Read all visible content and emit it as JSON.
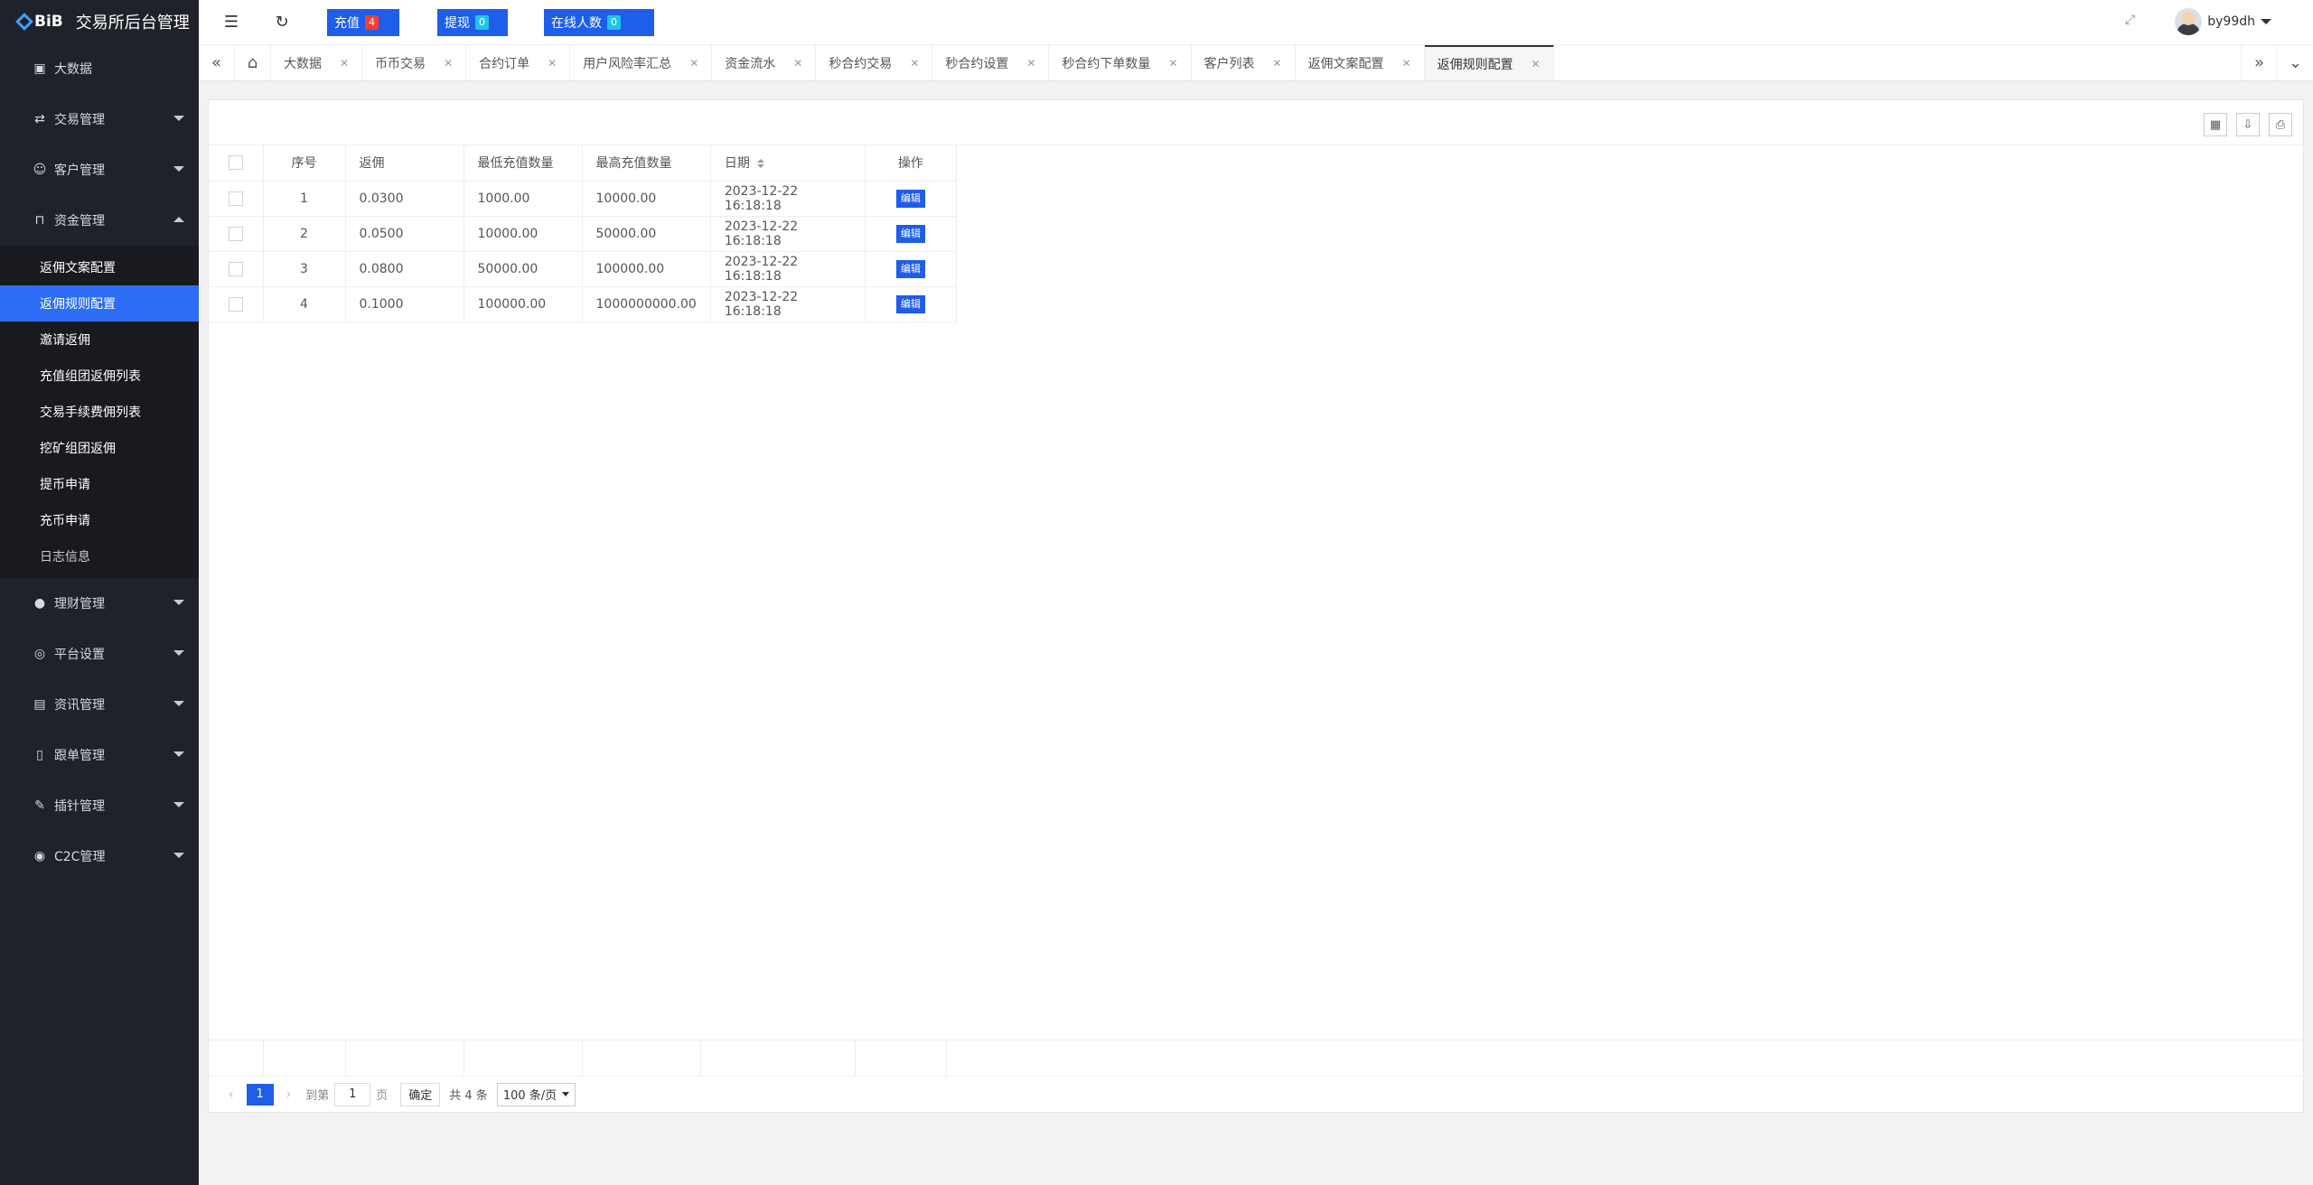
{
  "app": {
    "logo_text": "BiB",
    "title": "交易所后台管理"
  },
  "sidebar": {
    "groups_top": [
      {
        "label": "大数据",
        "icon": "dashboard-icon"
      },
      {
        "label": "交易管理",
        "icon": "exchange-icon"
      },
      {
        "label": "客户管理",
        "icon": "users-icon"
      },
      {
        "label": "资金管理",
        "icon": "lock-icon"
      }
    ],
    "sub_items": [
      {
        "label": "返佣文案配置"
      },
      {
        "label": "返佣规则配置"
      },
      {
        "label": "邀请返佣"
      },
      {
        "label": "充值组团返佣列表"
      },
      {
        "label": "交易手续费佣列表"
      },
      {
        "label": "挖矿组团返佣"
      },
      {
        "label": "提币申请"
      },
      {
        "label": "充币申请"
      },
      {
        "label": "日志信息"
      }
    ],
    "groups_bottom": [
      {
        "label": "理财管理",
        "icon": "piggy-bank-icon"
      },
      {
        "label": "平台设置",
        "icon": "settings-icon"
      },
      {
        "label": "资讯管理",
        "icon": "news-icon"
      },
      {
        "label": "跟单管理",
        "icon": "document-icon"
      },
      {
        "label": "插针管理",
        "icon": "pin-icon"
      },
      {
        "label": "C2C管理",
        "icon": "c2c-icon"
      }
    ]
  },
  "header": {
    "recharge": {
      "label": "充值",
      "count": "4"
    },
    "withdraw": {
      "label": "提现",
      "count": "0"
    },
    "online": {
      "label": "在线人数",
      "count": "0"
    },
    "username": "by99dh"
  },
  "tabs": [
    {
      "label": "大数据"
    },
    {
      "label": "币币交易"
    },
    {
      "label": "合约订单"
    },
    {
      "label": "用户风险率汇总"
    },
    {
      "label": "资金流水"
    },
    {
      "label": "秒合约交易"
    },
    {
      "label": "秒合约设置"
    },
    {
      "label": "秒合约下单数量"
    },
    {
      "label": "客户列表"
    },
    {
      "label": "返佣文案配置"
    },
    {
      "label": "返佣规则配置"
    }
  ],
  "table": {
    "headers": {
      "seq": "序号",
      "rebate": "返佣",
      "min": "最低充值数量",
      "max": "最高充值数量",
      "date": "日期",
      "op": "操作"
    },
    "rows": [
      {
        "seq": "1",
        "rebate": "0.0300",
        "min": "1000.00",
        "max": "10000.00",
        "date": "2023-12-22 16:18:18",
        "op": "编辑"
      },
      {
        "seq": "2",
        "rebate": "0.0500",
        "min": "10000.00",
        "max": "50000.00",
        "date": "2023-12-22 16:18:18",
        "op": "编辑"
      },
      {
        "seq": "3",
        "rebate": "0.0800",
        "min": "50000.00",
        "max": "100000.00",
        "date": "2023-12-22 16:18:18",
        "op": "编辑"
      },
      {
        "seq": "4",
        "rebate": "0.1000",
        "min": "100000.00",
        "max": "1000000000.00",
        "date": "2023-12-22 16:18:18",
        "op": "编辑"
      }
    ]
  },
  "pager": {
    "current_page": "1",
    "goto_label": "到第",
    "goto_value": "1",
    "page_unit": "页",
    "confirm": "确定",
    "total": "共 4 条",
    "page_size": "100 条/页"
  }
}
